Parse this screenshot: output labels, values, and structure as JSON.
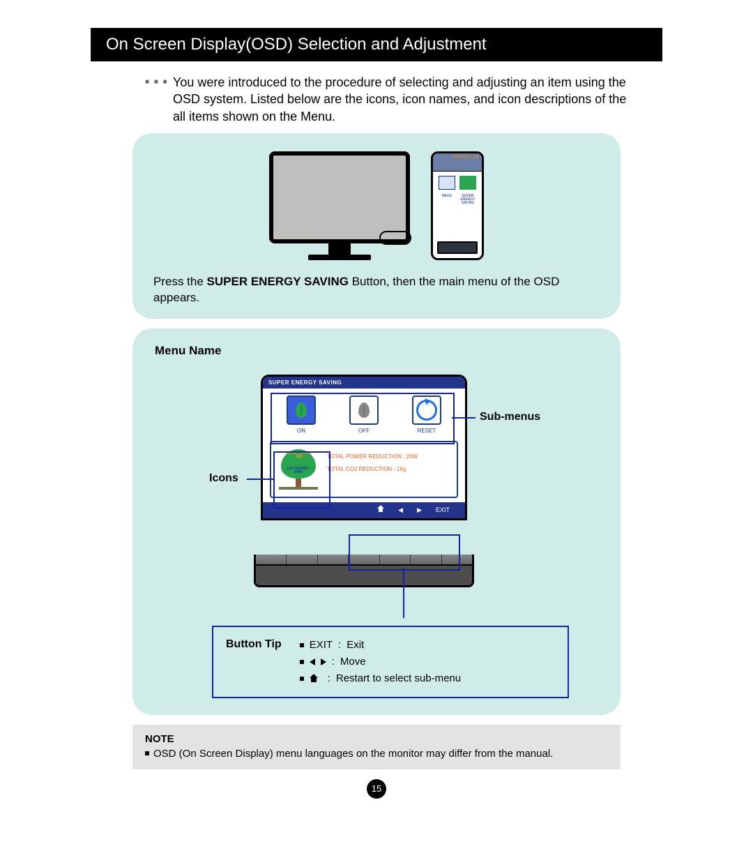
{
  "title": "On Screen Display(OSD) Selection and Adjustment",
  "intro": "You were introduced to the procedure of selecting and adjusting an item using the OSD system. Listed below are the icons, icon names, and icon descriptions of the all items shown on the Menu.",
  "zoom": {
    "header": "ONITOR SE",
    "menu_label": "MENU",
    "ses_label": "SUPER ENERGY SAVING"
  },
  "panel1_caption_prefix": "Press the ",
  "panel1_caption_bold": "SUPER ENERGY SAVING",
  "panel1_caption_suffix": " Button, then the main menu of the OSD appears.",
  "menu_name_label": "Menu Name",
  "icons_label": "Icons",
  "submenus_label": "Sub-menus",
  "osd": {
    "title": "SUPER ENERGY SAVING",
    "on": "ON",
    "off": "OFF",
    "reset": "RESET",
    "tree_super": "SUPER SAVING : 4Wh",
    "tree_led": "LED SAVING : 15Wh",
    "metric1": "TOTAL POWER REDUCTION : 20W",
    "metric2": "TOTAL CO2 REDUCTION : 16g",
    "nav_exit": "EXIT"
  },
  "button_tip": {
    "label": "Button Tip",
    "exit_key": "EXIT",
    "exit_desc": "Exit",
    "move_desc": "Move",
    "restart_desc": "Restart to select sub-menu"
  },
  "note": {
    "title": "NOTE",
    "body": "OSD (On Screen Display) menu languages on the monitor may differ from the manual."
  },
  "page_number": "15"
}
